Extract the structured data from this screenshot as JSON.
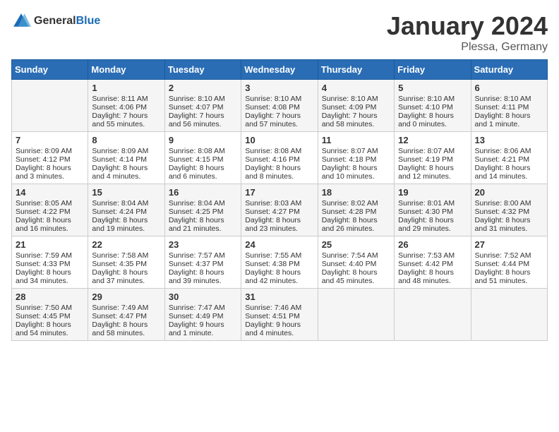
{
  "header": {
    "logo_general": "General",
    "logo_blue": "Blue",
    "month": "January 2024",
    "location": "Plessa, Germany"
  },
  "days_of_week": [
    "Sunday",
    "Monday",
    "Tuesday",
    "Wednesday",
    "Thursday",
    "Friday",
    "Saturday"
  ],
  "weeks": [
    [
      {
        "day": "",
        "info": ""
      },
      {
        "day": "1",
        "info": "Sunrise: 8:11 AM\nSunset: 4:06 PM\nDaylight: 7 hours\nand 55 minutes."
      },
      {
        "day": "2",
        "info": "Sunrise: 8:10 AM\nSunset: 4:07 PM\nDaylight: 7 hours\nand 56 minutes."
      },
      {
        "day": "3",
        "info": "Sunrise: 8:10 AM\nSunset: 4:08 PM\nDaylight: 7 hours\nand 57 minutes."
      },
      {
        "day": "4",
        "info": "Sunrise: 8:10 AM\nSunset: 4:09 PM\nDaylight: 7 hours\nand 58 minutes."
      },
      {
        "day": "5",
        "info": "Sunrise: 8:10 AM\nSunset: 4:10 PM\nDaylight: 8 hours\nand 0 minutes."
      },
      {
        "day": "6",
        "info": "Sunrise: 8:10 AM\nSunset: 4:11 PM\nDaylight: 8 hours\nand 1 minute."
      }
    ],
    [
      {
        "day": "7",
        "info": "Sunrise: 8:09 AM\nSunset: 4:12 PM\nDaylight: 8 hours\nand 3 minutes."
      },
      {
        "day": "8",
        "info": "Sunrise: 8:09 AM\nSunset: 4:14 PM\nDaylight: 8 hours\nand 4 minutes."
      },
      {
        "day": "9",
        "info": "Sunrise: 8:08 AM\nSunset: 4:15 PM\nDaylight: 8 hours\nand 6 minutes."
      },
      {
        "day": "10",
        "info": "Sunrise: 8:08 AM\nSunset: 4:16 PM\nDaylight: 8 hours\nand 8 minutes."
      },
      {
        "day": "11",
        "info": "Sunrise: 8:07 AM\nSunset: 4:18 PM\nDaylight: 8 hours\nand 10 minutes."
      },
      {
        "day": "12",
        "info": "Sunrise: 8:07 AM\nSunset: 4:19 PM\nDaylight: 8 hours\nand 12 minutes."
      },
      {
        "day": "13",
        "info": "Sunrise: 8:06 AM\nSunset: 4:21 PM\nDaylight: 8 hours\nand 14 minutes."
      }
    ],
    [
      {
        "day": "14",
        "info": "Sunrise: 8:05 AM\nSunset: 4:22 PM\nDaylight: 8 hours\nand 16 minutes."
      },
      {
        "day": "15",
        "info": "Sunrise: 8:04 AM\nSunset: 4:24 PM\nDaylight: 8 hours\nand 19 minutes."
      },
      {
        "day": "16",
        "info": "Sunrise: 8:04 AM\nSunset: 4:25 PM\nDaylight: 8 hours\nand 21 minutes."
      },
      {
        "day": "17",
        "info": "Sunrise: 8:03 AM\nSunset: 4:27 PM\nDaylight: 8 hours\nand 23 minutes."
      },
      {
        "day": "18",
        "info": "Sunrise: 8:02 AM\nSunset: 4:28 PM\nDaylight: 8 hours\nand 26 minutes."
      },
      {
        "day": "19",
        "info": "Sunrise: 8:01 AM\nSunset: 4:30 PM\nDaylight: 8 hours\nand 29 minutes."
      },
      {
        "day": "20",
        "info": "Sunrise: 8:00 AM\nSunset: 4:32 PM\nDaylight: 8 hours\nand 31 minutes."
      }
    ],
    [
      {
        "day": "21",
        "info": "Sunrise: 7:59 AM\nSunset: 4:33 PM\nDaylight: 8 hours\nand 34 minutes."
      },
      {
        "day": "22",
        "info": "Sunrise: 7:58 AM\nSunset: 4:35 PM\nDaylight: 8 hours\nand 37 minutes."
      },
      {
        "day": "23",
        "info": "Sunrise: 7:57 AM\nSunset: 4:37 PM\nDaylight: 8 hours\nand 39 minutes."
      },
      {
        "day": "24",
        "info": "Sunrise: 7:55 AM\nSunset: 4:38 PM\nDaylight: 8 hours\nand 42 minutes."
      },
      {
        "day": "25",
        "info": "Sunrise: 7:54 AM\nSunset: 4:40 PM\nDaylight: 8 hours\nand 45 minutes."
      },
      {
        "day": "26",
        "info": "Sunrise: 7:53 AM\nSunset: 4:42 PM\nDaylight: 8 hours\nand 48 minutes."
      },
      {
        "day": "27",
        "info": "Sunrise: 7:52 AM\nSunset: 4:44 PM\nDaylight: 8 hours\nand 51 minutes."
      }
    ],
    [
      {
        "day": "28",
        "info": "Sunrise: 7:50 AM\nSunset: 4:45 PM\nDaylight: 8 hours\nand 54 minutes."
      },
      {
        "day": "29",
        "info": "Sunrise: 7:49 AM\nSunset: 4:47 PM\nDaylight: 8 hours\nand 58 minutes."
      },
      {
        "day": "30",
        "info": "Sunrise: 7:47 AM\nSunset: 4:49 PM\nDaylight: 9 hours\nand 1 minute."
      },
      {
        "day": "31",
        "info": "Sunrise: 7:46 AM\nSunset: 4:51 PM\nDaylight: 9 hours\nand 4 minutes."
      },
      {
        "day": "",
        "info": ""
      },
      {
        "day": "",
        "info": ""
      },
      {
        "day": "",
        "info": ""
      }
    ]
  ]
}
